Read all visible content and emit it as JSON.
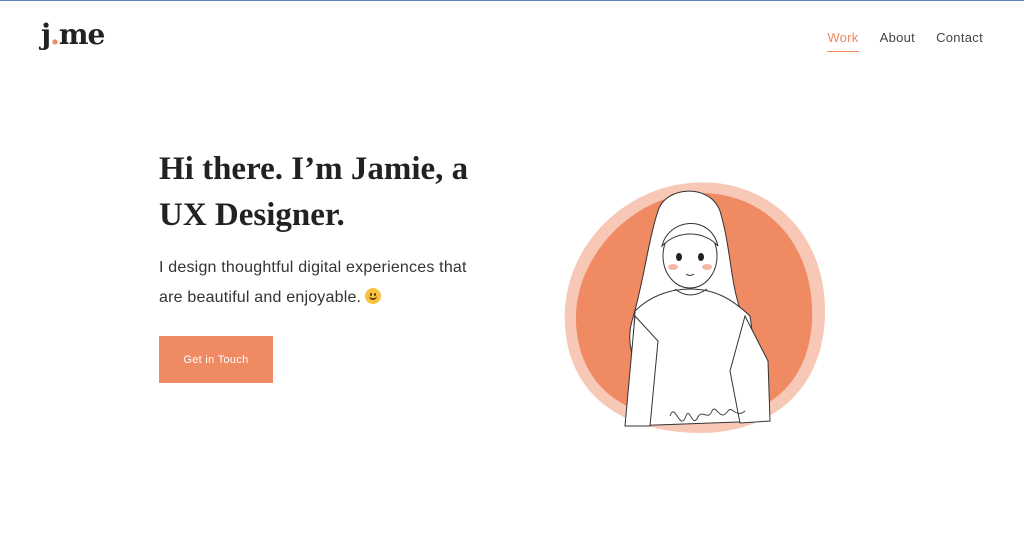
{
  "logo": {
    "prefix": "j",
    "dot": ".",
    "suffix": "me"
  },
  "nav": {
    "work": "Work",
    "about": "About",
    "contact": "Contact"
  },
  "hero": {
    "title": "Hi there. I’m Jamie, a UX Designer.",
    "subtitle": "I design thoughtful digital experiences that are beautiful and enjoyable.",
    "cta_label": "Get in Touch",
    "emoji": "smiling-face"
  },
  "colors": {
    "accent": "#ef8a63",
    "accent_light": "#f6c8b5",
    "text": "#222222"
  }
}
